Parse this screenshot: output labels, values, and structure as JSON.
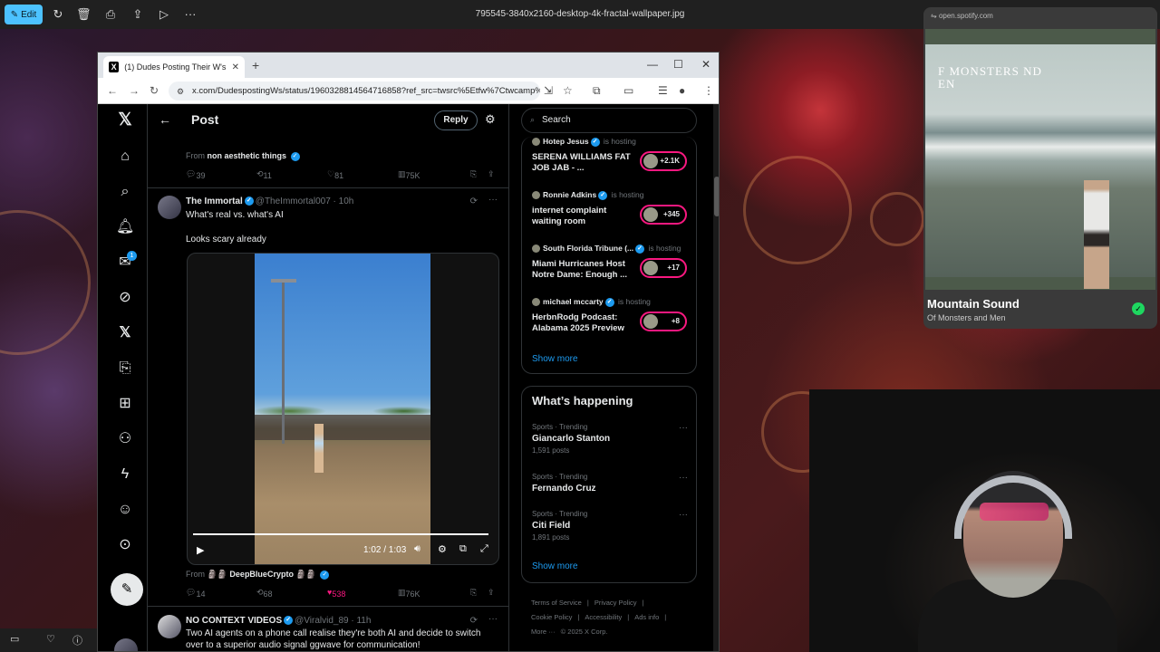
{
  "viewer": {
    "edit_label": "Edit",
    "file_name": "795545-3840x2160-desktop-4k-fractal-wallpaper.jpg"
  },
  "browser": {
    "tab_title": "(1) Dudes Posting Their W's on",
    "url": "x.com/DudespostingWs/status/1960328814564716858?ref_src=twsrc%5Etfw%7Ctwcamp%..."
  },
  "post_header": {
    "title": "Post",
    "reply_label": "Reply"
  },
  "prev_tweet": {
    "from_prefix": "From",
    "from_name": "non aesthetic things",
    "stats": {
      "replies": "39",
      "reposts": "11",
      "likes": "81",
      "views": "75K"
    }
  },
  "tweet": {
    "name": "The Immortal",
    "handle": "@TheImmortal007",
    "time": "· 10h",
    "line1": "What's real vs. what's AI",
    "line2": "Looks scary already",
    "video_time": "1:02 / 1:03",
    "video_progress": 0.98,
    "from_prefix": "From",
    "from_name": "🗿🗿 DeepBlueCrypto 🗿🗿",
    "stats": {
      "replies": "14",
      "reposts": "68",
      "likes": "538",
      "views": "76K"
    }
  },
  "next_tweet": {
    "name": "NO CONTEXT VIDEOS",
    "handle": "@Viralvid_89",
    "time": "· 11h",
    "text": "Two AI agents on a phone call realise they're both AI and decide to switch over to a superior audio signal ggwave for communication!"
  },
  "search": {
    "placeholder": "Search"
  },
  "spaces": [
    {
      "host": "Hotep Jesus",
      "status": "is hosting",
      "title": "SERENA WILLIAMS FAT JOB JAB - ...",
      "count": "+2.1K"
    },
    {
      "host": "Ronnie Adkins",
      "status": "is hosting",
      "title": "internet complaint waiting room",
      "count": "+345"
    },
    {
      "host": "South Florida Tribune (...",
      "status": "is hosting",
      "title": "Miami Hurricanes Host Notre Dame: Enough ...",
      "count": "+17"
    },
    {
      "host": "michael mccarty",
      "status": "is hosting",
      "title": "HerbnRodg Podcast: Alabama 2025 Preview",
      "count": "+8"
    }
  ],
  "spaces_show_more": "Show more",
  "happening": {
    "title": "What’s happening",
    "trends": [
      {
        "category": "Sports · Trending",
        "name": "Giancarlo Stanton",
        "count": "1,591 posts"
      },
      {
        "category": "Sports · Trending",
        "name": "Fernando Cruz",
        "count": ""
      },
      {
        "category": "Sports · Trending",
        "name": "Citi Field",
        "count": "1,891 posts"
      }
    ],
    "show_more": "Show more"
  },
  "footer": {
    "links": [
      "Terms of Service",
      "|",
      "Privacy Policy",
      "|",
      "Cookie Policy",
      "|",
      "Accessibility",
      "|",
      "Ads info",
      "|",
      "More ···",
      "© 2025 X Corp."
    ]
  },
  "notifications_badge": "1",
  "spotify": {
    "url": "open.spotify.com",
    "album_text": "F MONSTERS ND EN",
    "song": "Mountain Sound",
    "artist": "Of Monsters and Men"
  },
  "colors": {
    "accent": "#1d9bf0",
    "like": "#f91880",
    "spotify_green": "#1ed760",
    "edit": "#4cc2ff"
  }
}
